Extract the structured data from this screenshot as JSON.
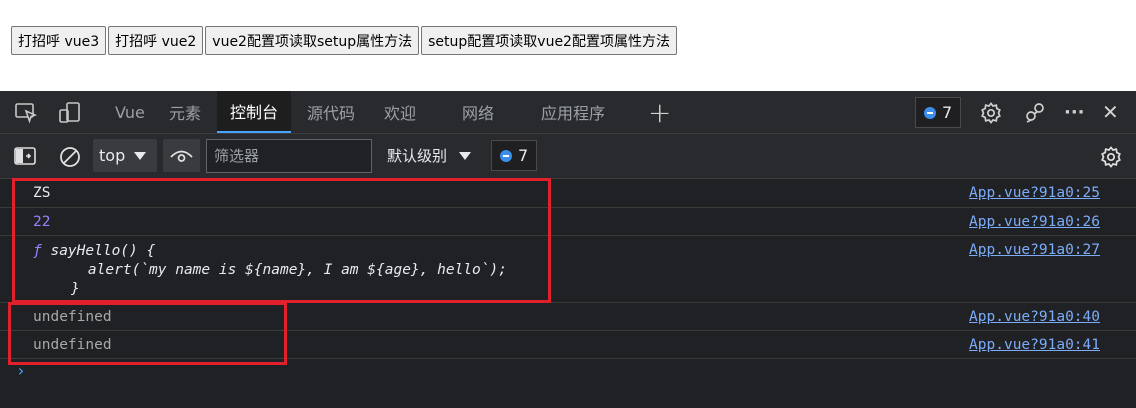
{
  "page": {
    "buttons": [
      "打招呼 vue3",
      "打招呼 vue2",
      "vue2配置项读取setup属性方法",
      "setup配置项读取vue2配置项属性方法"
    ]
  },
  "devtools": {
    "tabs": [
      {
        "label": "Vue",
        "active": false
      },
      {
        "label": "元素",
        "active": false
      },
      {
        "label": "控制台",
        "active": true
      },
      {
        "label": "源代码",
        "active": false
      },
      {
        "label": "欢迎",
        "active": false
      },
      {
        "label": "网络",
        "active": false
      },
      {
        "label": "应用程序",
        "active": false
      }
    ],
    "add_tab_glyph": "+",
    "message_count": "7",
    "more_glyph": "···",
    "close_glyph": "✕",
    "toolbar": {
      "context": "top",
      "filter_placeholder": "筛选器",
      "level": "默认级别",
      "message_count": "7"
    },
    "console": {
      "rows": [
        {
          "text": "ZS",
          "kind": "string",
          "source": "App.vue?91a0:25"
        },
        {
          "text": "22",
          "kind": "number",
          "source": "App.vue?91a0:26"
        },
        {
          "fn_keyword": "ƒ",
          "fn_line1": "sayHello() {",
          "fn_line2": "    alert(`my name is ${name}, I am ${age}, hello`);",
          "fn_line3": "}",
          "kind": "function",
          "source": "App.vue?91a0:27"
        },
        {
          "text": "undefined",
          "kind": "undefined",
          "source": "App.vue?91a0:40"
        },
        {
          "text": "undefined",
          "kind": "undefined",
          "source": "App.vue?91a0:41"
        }
      ],
      "prompt": "›"
    },
    "colors": {
      "accent": "#4aa3ff",
      "link": "#7cacf8",
      "number": "#9980ff",
      "highlight_box": "#e0202a",
      "background": "#202124"
    }
  }
}
